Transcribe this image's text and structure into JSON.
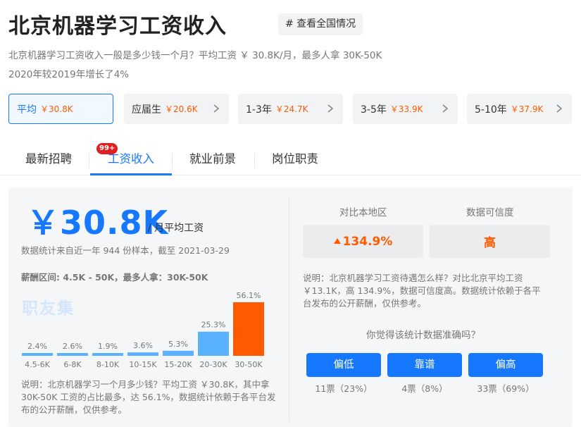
{
  "header": {
    "title": "北京机器学习工资收入",
    "tag_button": "# 查看全国情况",
    "summary_line1": "北京机器学习工资收入一般是多少钱一个月？平均工资 ￥ 30.8K/月，最多人拿 30K-50K",
    "summary_line2": "2020年较2019年增长了4%"
  },
  "salary_cards": [
    {
      "label": "平均",
      "value": "￥30.8K",
      "active": true
    },
    {
      "label": "应届生",
      "value": "￥20.6K"
    },
    {
      "label": "1-3年",
      "value": "￥24.7K"
    },
    {
      "label": "3-5年",
      "value": "￥33.9K"
    },
    {
      "label": "5-10年",
      "value": "￥37.9K"
    }
  ],
  "tabs": [
    {
      "label": "最新招聘",
      "badge": "99+"
    },
    {
      "label": "工资收入",
      "active": true
    },
    {
      "label": "就业前景"
    },
    {
      "label": "岗位职责"
    }
  ],
  "left": {
    "big_value": "￥30.8K",
    "big_unit": "/ 月平均工资",
    "stat_note": "数据统计来自近一年 944 份样本，截至 2021-03-29",
    "range_text": "薪酬区间: 4.5K - 50K，最多人拿：30K-50K",
    "watermark": "职友集",
    "note": "说明：北京机器学习一个月多少钱？平均工资 ￥30.8K，其中拿 30K-50K 工资的占比最多，达 56.1%，数据统计依赖于各平台发布的公开薪酬，仅供参考。"
  },
  "chart_data": {
    "type": "bar",
    "categories": [
      "4.5-6K",
      "6-8K",
      "8-10K",
      "10-15K",
      "15-20K",
      "20-30K",
      "30-50K"
    ],
    "values": [
      2.4,
      2.6,
      1.9,
      3.6,
      5.3,
      25.3,
      56.1
    ],
    "value_labels": [
      "2.4%",
      "2.6%",
      "1.9%",
      "3.6%",
      "5.3%",
      "25.3%",
      "56.1%"
    ],
    "title": "",
    "xlabel": "",
    "ylabel": "",
    "ylim": [
      0,
      56.1
    ],
    "grid": false,
    "legend": "none",
    "colors": {
      "normal": "#5ab1ff",
      "highlight": "#ff5a00",
      "label": "#777777"
    }
  },
  "right": {
    "compare_label": "对比本地区",
    "trust_label": "数据可信度",
    "compare_value": "134.9%",
    "trust_value": "高",
    "note": "说明：北京机器学习工资待遇怎么样？对比北京平均工资 ￥13.1K，高 134.9%，数据可信度高。数据统计依赖于各平台发布的公开薪酬，仅供参考。",
    "question": "你觉得该统计数据准确吗？",
    "votes": [
      {
        "label": "偏低",
        "count": "11票（23%）"
      },
      {
        "label": "靠谱",
        "count": "4票（8%）"
      },
      {
        "label": "偏高",
        "count": "33票（69%）"
      }
    ]
  },
  "colors": {
    "accent": "#1677ff",
    "orange": "#ff5a00",
    "badge": "#e02020"
  },
  "icons": {
    "card_arrow": "chevron-right-icon",
    "up_arrow": "arrow-up-icon"
  }
}
